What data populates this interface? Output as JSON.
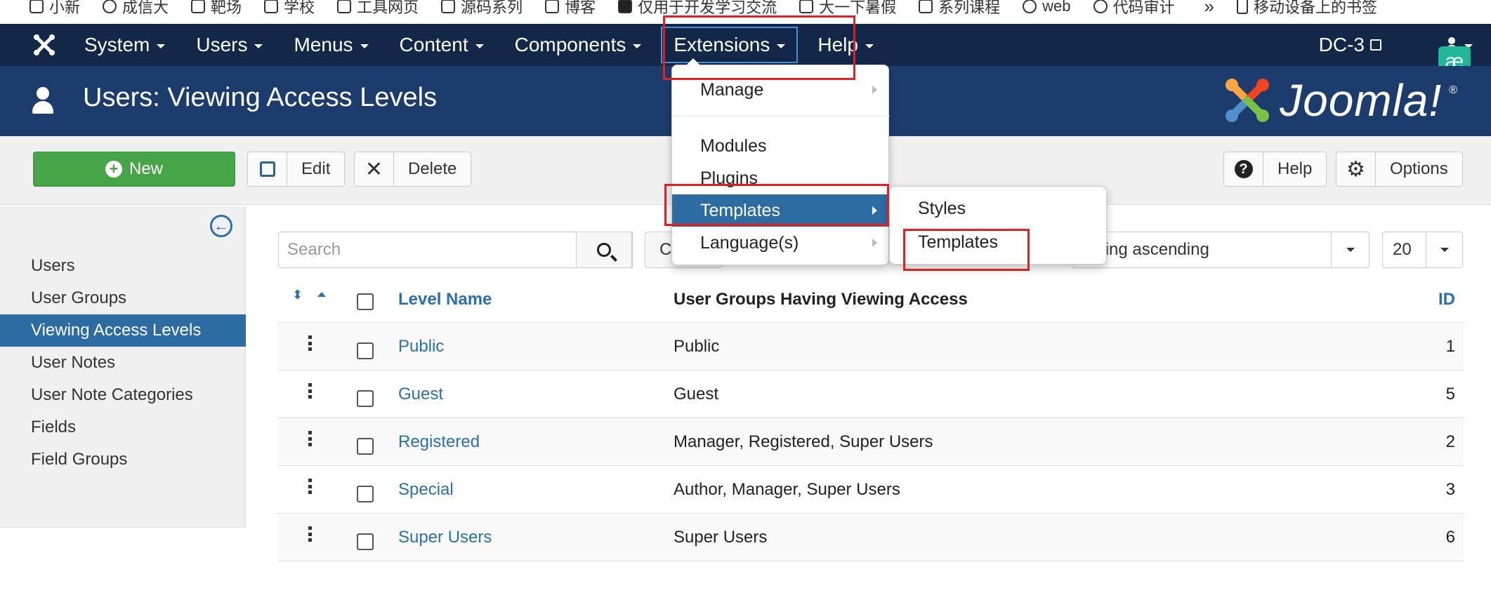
{
  "bookmarks": [
    {
      "label": "小新",
      "icon": "folder-icon"
    },
    {
      "label": "成信大",
      "icon": "globe-icon"
    },
    {
      "label": "靶场",
      "icon": "folder-icon"
    },
    {
      "label": "学校",
      "icon": "folder-icon"
    },
    {
      "label": "工具网页",
      "icon": "folder-icon"
    },
    {
      "label": "源码系列",
      "icon": "folder-icon"
    },
    {
      "label": "博客",
      "icon": "folder-icon"
    },
    {
      "label": "仅用于开发学习交流",
      "icon": "site-icon"
    },
    {
      "label": "大一下暑假",
      "icon": "folder-icon"
    },
    {
      "label": "系列课程",
      "icon": "folder-icon"
    },
    {
      "label": "web",
      "icon": "globe-icon"
    },
    {
      "label": "代码审计",
      "icon": "site-icon"
    },
    {
      "label": "移动设备上的书签",
      "icon": "phone-icon"
    }
  ],
  "bookmarks_more": "»",
  "navbar": {
    "items": [
      {
        "label": "System"
      },
      {
        "label": "Users"
      },
      {
        "label": "Menus"
      },
      {
        "label": "Content"
      },
      {
        "label": "Components"
      },
      {
        "label": "Extensions"
      },
      {
        "label": "Help"
      }
    ],
    "site_label": "DC-3",
    "ae_badge": "æ"
  },
  "header": {
    "title": "Users: Viewing Access Levels",
    "brand": "Joomla!",
    "brand_mark": "®"
  },
  "toolbar": {
    "new_label": "New",
    "edit_label": "Edit",
    "delete_label": "Delete",
    "help_label": "Help",
    "options_label": "Options"
  },
  "sidebar": {
    "items": [
      {
        "label": "Users"
      },
      {
        "label": "User Groups"
      },
      {
        "label": "Viewing Access Levels"
      },
      {
        "label": "User Notes"
      },
      {
        "label": "User Note Categories"
      },
      {
        "label": "Fields"
      },
      {
        "label": "Field Groups"
      }
    ]
  },
  "filters": {
    "search_placeholder": "Search",
    "clear_label": "C",
    "sort_value": "dering ascending",
    "limit_value": "20"
  },
  "table": {
    "headers": {
      "name": "Level Name",
      "groups": "User Groups Having Viewing Access",
      "id": "ID"
    },
    "rows": [
      {
        "name": "Public",
        "groups": "Public",
        "id": "1"
      },
      {
        "name": "Guest",
        "groups": "Guest",
        "id": "5"
      },
      {
        "name": "Registered",
        "groups": "Manager, Registered, Super Users",
        "id": "2"
      },
      {
        "name": "Special",
        "groups": "Author, Manager, Super Users",
        "id": "3"
      },
      {
        "name": "Super Users",
        "groups": "Super Users",
        "id": "6"
      }
    ]
  },
  "extensions_menu": {
    "items": [
      {
        "label": "Manage"
      },
      {
        "label": "Modules"
      },
      {
        "label": "Plugins"
      },
      {
        "label": "Templates"
      },
      {
        "label": "Language(s)"
      }
    ]
  },
  "templates_submenu": {
    "items": [
      {
        "label": "Styles"
      },
      {
        "label": "Templates"
      }
    ]
  },
  "colors": {
    "navbar": "#132849",
    "titlebar": "#1b3c6d",
    "accent": "#2d6ca2",
    "new_button": "#46a546",
    "annotation": "#e02020"
  }
}
